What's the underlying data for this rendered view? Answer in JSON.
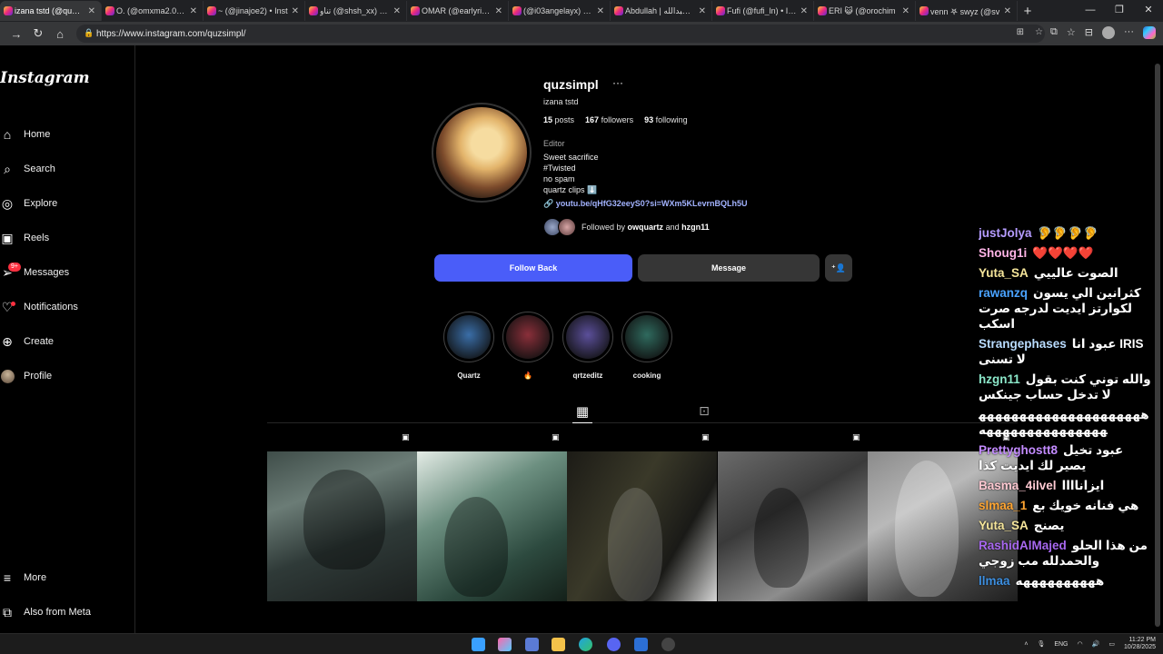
{
  "browser": {
    "tabs": [
      {
        "title": "izana tstd (@quzsim",
        "active": true
      },
      {
        "title": "O. (@omxma2.0) • I",
        "active": false
      },
      {
        "title": "~ (@jinajoe2) • Inst",
        "active": false
      },
      {
        "title": "تناو (@shsh_xx) • In",
        "active": false
      },
      {
        "title": "OMAR (@earlyrisk)",
        "active": false
      },
      {
        "title": "(@i03angelayx) • In",
        "active": false
      },
      {
        "title": "Abdullah | عبدالله (@",
        "active": false
      },
      {
        "title": "Fufi (@fufi_ln) • Inst",
        "active": false
      },
      {
        "title": "ERI 😺 (@orochim",
        "active": false
      },
      {
        "title": "venn 𖤐 swyz (@sv",
        "active": false
      }
    ],
    "new_tab": "+",
    "url": "https://www.instagram.com/quzsimpl/"
  },
  "sidebar": {
    "logo": "Instagram",
    "items": [
      {
        "label": "Home",
        "icon": "home-icon",
        "glyph": "⌂"
      },
      {
        "label": "Search",
        "icon": "search-icon",
        "glyph": "⌕"
      },
      {
        "label": "Explore",
        "icon": "explore-icon",
        "glyph": "◎"
      },
      {
        "label": "Reels",
        "icon": "reels-icon",
        "glyph": "▣"
      },
      {
        "label": "Messages",
        "icon": "messages-icon",
        "glyph": "➢",
        "badge": "9+"
      },
      {
        "label": "Notifications",
        "icon": "heart-icon",
        "glyph": "♡"
      },
      {
        "label": "Create",
        "icon": "create-icon",
        "glyph": "⊕"
      },
      {
        "label": "Profile",
        "icon": "avatar",
        "glyph": ""
      }
    ],
    "bottom": [
      {
        "label": "More",
        "icon": "menu-icon",
        "glyph": "≡"
      },
      {
        "label": "Also from Meta",
        "icon": "meta-icon",
        "glyph": "⧉"
      }
    ]
  },
  "profile": {
    "username": "quzsimpl",
    "more": "···",
    "full_name": "izana tstd",
    "posts": "15",
    "posts_label": "posts",
    "followers": "167",
    "followers_label": "followers",
    "following": "93",
    "following_label": "following",
    "category": "Editor",
    "bio": [
      "Sweet sacrifice",
      "#Twisted",
      "no spam",
      "quartz clips ⬇️"
    ],
    "link": "youtu.be/qHfG32eeyS0?si=WXm5KLevrnBQLh5U",
    "followed_by_prefix": "Followed by",
    "followed_by_1": "owquartz",
    "followed_by_and": "and",
    "followed_by_2": "hzgn11",
    "follow_back": "Follow Back",
    "message": "Message",
    "highlights": [
      {
        "label": "Quartz",
        "color": "#3a6ea8"
      },
      {
        "label": "🔥",
        "color": "#8a2f3a"
      },
      {
        "label": "qrtzeditz",
        "color": "#5b4f9a"
      },
      {
        "label": "cooking",
        "color": "#2f6a5e"
      }
    ]
  },
  "chat": [
    {
      "user": "justJolya",
      "color": "#b59cff",
      "text": "🦻🦻🦻🦻"
    },
    {
      "user": "Shoug1i",
      "color": "#ffb4e6",
      "text": "❤️❤️❤️❤️"
    },
    {
      "user": "Yuta_SA",
      "color": "#f5e59a",
      "text": "الصوت عالييي"
    },
    {
      "user": "rawanzq",
      "color": "#4aa3ff",
      "text": "كثرانين الي يسون لكوارتز ايديت لدرجه صرت اسكب"
    },
    {
      "user": "Strangephases",
      "color": "#b9dcff",
      "text": "عبود انا IRIS لا تسنى"
    },
    {
      "user": "hzgn11",
      "color": "#8be7c9",
      "text": "والله توني كنت بقول لا تدخل حساب جينكس"
    },
    {
      "user": "",
      "color": "#ffffff",
      "text": "ههههههههههههههههههههههههههههههههههههه"
    },
    {
      "user": "Prettyghostt8",
      "color": "#c38bff",
      "text": "عبود تخيل يصير لك ايديت كذا"
    },
    {
      "user": "Basma_4ilvel",
      "color": "#ffc9d2",
      "text": "ايزاناااا"
    },
    {
      "user": "slmaa_1",
      "color": "#ffa531",
      "text": "هي فنانه خويك بع"
    },
    {
      "user": "Yuta_SA",
      "color": "#f5e59a",
      "text": "يصنج"
    },
    {
      "user": "RashidAlMajed",
      "color": "#a868f0",
      "text": "من هذا الحلو والحمدلله مب زوجي"
    },
    {
      "user": "llmaa",
      "color": "#3d8fe0",
      "text": "ههههههههههه"
    }
  ],
  "taskbar": {
    "lang": "ENG",
    "time": "11:22 PM",
    "date": "10/28/2025"
  },
  "colors": {
    "follow_button": "#4a5df9",
    "secondary_button": "#363636",
    "notification_red": "#ff3040"
  }
}
